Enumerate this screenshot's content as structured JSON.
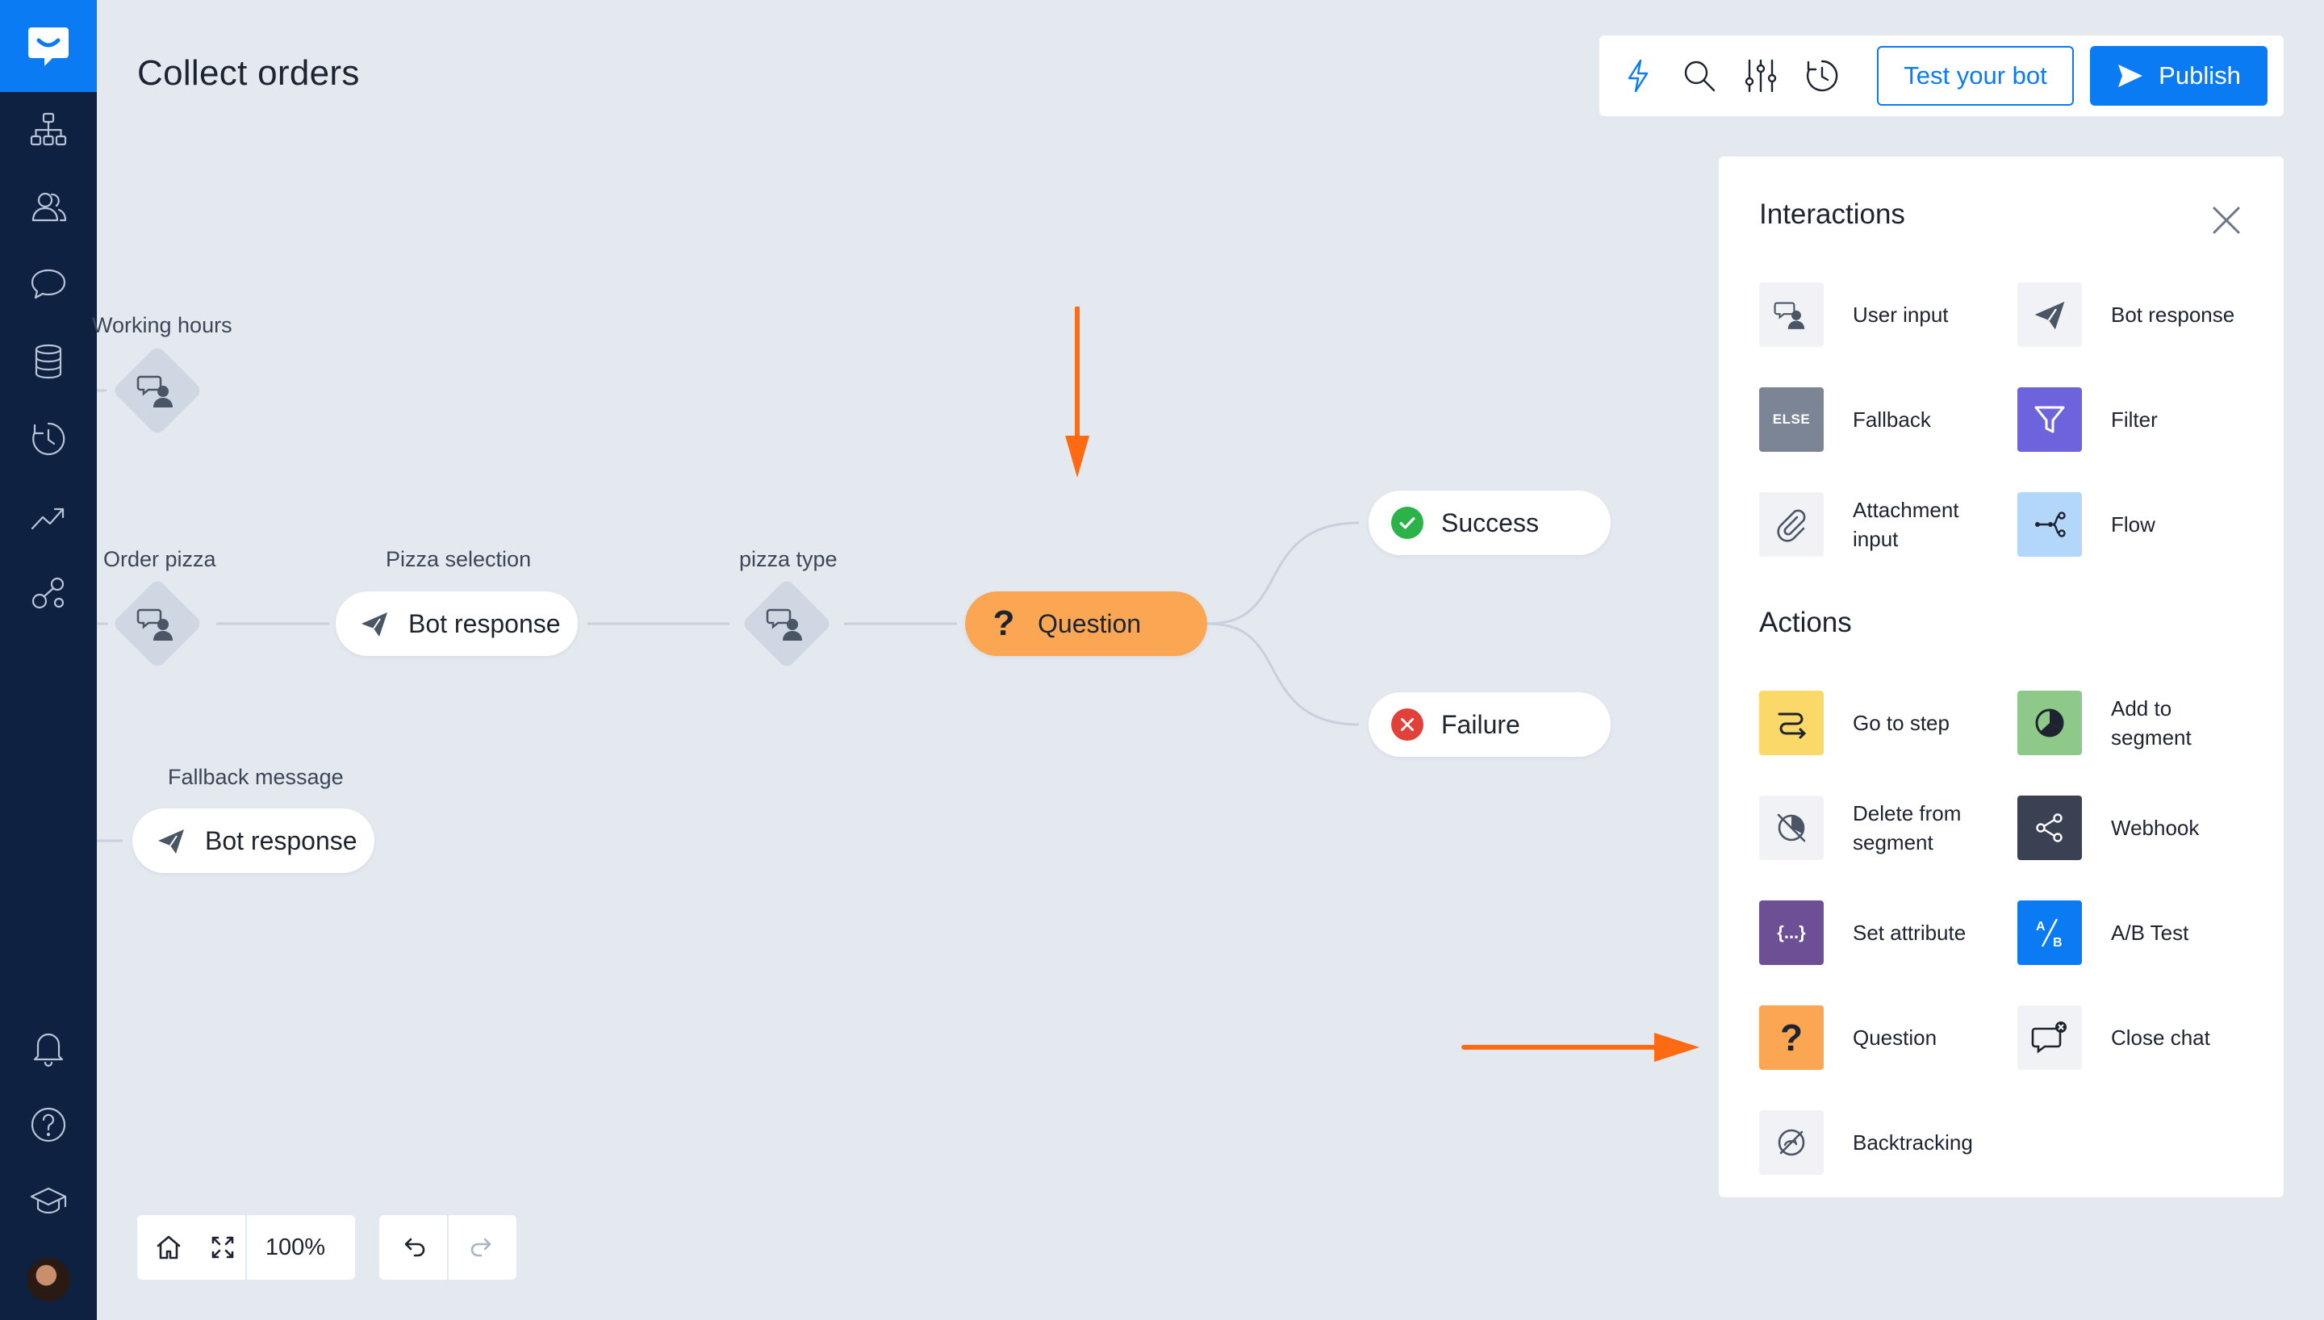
{
  "app": {
    "page_title": "Collect orders"
  },
  "toolbar": {
    "test_label": "Test your bot",
    "publish_label": "Publish",
    "icons": [
      "lightning-icon",
      "search-icon",
      "sliders-icon",
      "history-icon"
    ]
  },
  "sidebar": {
    "items": [
      "stories-icon",
      "audience-icon",
      "chat-icon",
      "database-icon",
      "history-icon",
      "reports-icon",
      "integrations-icon"
    ],
    "bottom": [
      "bell-icon",
      "help-icon",
      "academy-icon",
      "avatar"
    ]
  },
  "canvas": {
    "nodes": {
      "working_hours": {
        "label": "Working hours"
      },
      "order_pizza": {
        "label": "Order pizza"
      },
      "pizza_selection": {
        "label": "Pizza selection",
        "text": "Bot response"
      },
      "pizza_type": {
        "label": "pizza type"
      },
      "question": {
        "text": "Question"
      },
      "success": {
        "text": "Success"
      },
      "failure": {
        "text": "Failure"
      },
      "fallback_message": {
        "label": "Fallback message",
        "text": "Bot response"
      }
    }
  },
  "panel": {
    "interactions_title": "Interactions",
    "actions_title": "Actions",
    "interactions": [
      {
        "label": "User input",
        "color": "#f0f2f5"
      },
      {
        "label": "Bot response",
        "color": "#f0f2f5"
      },
      {
        "label": "Fallback",
        "color": "#7c8596",
        "tile_text": "ELSE"
      },
      {
        "label": "Filter",
        "color": "#6d64dd"
      },
      {
        "label": "Attachment input",
        "color": "#f0f2f5"
      },
      {
        "label": "Flow",
        "color": "#b3d6fb"
      }
    ],
    "actions": [
      {
        "label": "Go to step",
        "color": "#fbd969"
      },
      {
        "label": "Add to segment",
        "color": "#8fc98a"
      },
      {
        "label": "Delete from segment",
        "color": "#f0f2f5"
      },
      {
        "label": "Webhook",
        "color": "#3a4152"
      },
      {
        "label": "Set attribute",
        "color": "#6c4f94",
        "tile_text": "{...}"
      },
      {
        "label": "A/B Test",
        "color": "#0a7bf2"
      },
      {
        "label": "Question",
        "color": "#fba652",
        "tile_text": "?"
      },
      {
        "label": "Close chat",
        "color": "#f0f2f5"
      },
      {
        "label": "Backtracking",
        "color": "#f0f2f5"
      }
    ]
  },
  "controls": {
    "zoom": "100%"
  },
  "colors": {
    "accent": "#0a7bf2",
    "sidebar": "#0f2141",
    "question": "#fba652",
    "arrow": "#ff6a13",
    "success": "#2bb34a",
    "failure": "#e0413a"
  }
}
